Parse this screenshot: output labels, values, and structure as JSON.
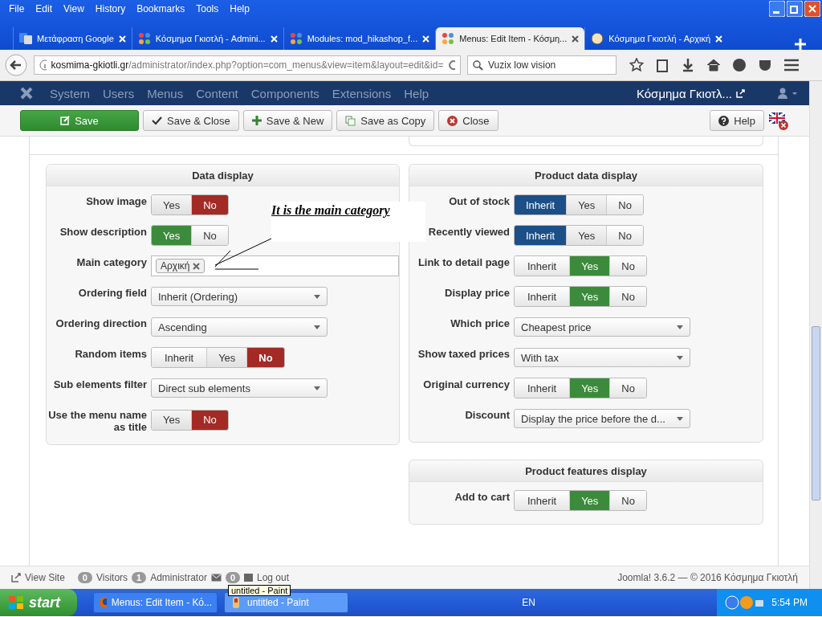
{
  "menu_bar": [
    "File",
    "Edit",
    "View",
    "History",
    "Bookmarks",
    "Tools",
    "Help"
  ],
  "tabs": [
    {
      "label": "Μετάφραση Google",
      "selected": false
    },
    {
      "label": "Κόσμημα Γκιοτλή - Admini...",
      "selected": false
    },
    {
      "label": "Modules: mod_hikashop_f...",
      "selected": false
    },
    {
      "label": "Menus: Edit Item - Κόσμη...",
      "selected": true
    },
    {
      "label": "Κόσμημα Γκιοτλή - Αρχική",
      "selected": false
    }
  ],
  "address": {
    "domain": "kosmima-gkiotli.gr",
    "path": "/administrator/index.php?option=com_menus&view=item&layout=edit&id="
  },
  "search": {
    "value": "Vuzix low vision"
  },
  "admin_menu": [
    "System",
    "Users",
    "Menus",
    "Content",
    "Components",
    "Extensions",
    "Help"
  ],
  "site_name": "Κόσμημα Γκιοτλ...",
  "toolbar": [
    {
      "label": "Save",
      "kind": "save"
    },
    {
      "label": "Save & Close",
      "kind": "check"
    },
    {
      "label": "Save & New",
      "kind": "new"
    },
    {
      "label": "Save as Copy",
      "kind": "copy"
    },
    {
      "label": "Close",
      "kind": "close"
    }
  ],
  "help_button": "Help",
  "panels": [
    {
      "title": "Data display",
      "rows": [
        {
          "label": "Show image",
          "kind": "toggle",
          "options": [
            {
              "label": "Yes",
              "kind": "yes",
              "selected": false
            },
            {
              "label": "No",
              "kind": "no",
              "selected": true
            }
          ]
        },
        {
          "label": "Show description",
          "kind": "toggle",
          "options": [
            {
              "label": "Yes",
              "kind": "yes",
              "selected": true
            },
            {
              "label": "No",
              "kind": "no",
              "selected": false
            }
          ]
        },
        {
          "label": "Main category",
          "kind": "tags",
          "tags": [
            "Αρχική"
          ]
        },
        {
          "label": "Ordering field",
          "kind": "select",
          "value": "Inherit (Ordering)"
        },
        {
          "label": "Ordering direction",
          "kind": "select",
          "value": "Ascending"
        },
        {
          "label": "Random items",
          "kind": "toggle",
          "options": [
            {
              "label": "Inherit",
              "kind": "inherit",
              "selected": false
            },
            {
              "label": "Yes",
              "kind": "yes",
              "selected": false
            },
            {
              "label": "No",
              "kind": "no",
              "selected": true
            }
          ]
        },
        {
          "label": "Sub elements filter",
          "kind": "select",
          "value": "Direct sub elements"
        },
        {
          "label": "Use the menu name as title",
          "kind": "toggle",
          "options": [
            {
              "label": "Yes",
              "kind": "yes",
              "selected": false
            },
            {
              "label": "No",
              "kind": "no",
              "selected": true
            }
          ]
        }
      ]
    },
    {
      "title": "Product data display",
      "rows": [
        {
          "label": "Out of stock",
          "kind": "toggle",
          "options": [
            {
              "label": "Inherit",
              "kind": "inherit",
              "selected": true
            },
            {
              "label": "Yes",
              "kind": "yes",
              "selected": false
            },
            {
              "label": "No",
              "kind": "no",
              "selected": false
            }
          ]
        },
        {
          "label": "Recently viewed",
          "kind": "toggle",
          "options": [
            {
              "label": "Inherit",
              "kind": "inherit",
              "selected": true
            },
            {
              "label": "Yes",
              "kind": "yes",
              "selected": false
            },
            {
              "label": "No",
              "kind": "no",
              "selected": false
            }
          ]
        },
        {
          "label": "Link to detail page",
          "kind": "toggle",
          "options": [
            {
              "label": "Inherit",
              "kind": "inherit",
              "selected": false
            },
            {
              "label": "Yes",
              "kind": "yes",
              "selected": true
            },
            {
              "label": "No",
              "kind": "no",
              "selected": false
            }
          ]
        },
        {
          "label": "Display price",
          "kind": "toggle",
          "options": [
            {
              "label": "Inherit",
              "kind": "inherit",
              "selected": false
            },
            {
              "label": "Yes",
              "kind": "yes",
              "selected": true
            },
            {
              "label": "No",
              "kind": "no",
              "selected": false
            }
          ]
        },
        {
          "label": "Which price",
          "kind": "select",
          "value": "Cheapest price"
        },
        {
          "label": "Show taxed prices",
          "kind": "select",
          "value": "With tax"
        },
        {
          "label": "Original currency",
          "kind": "toggle",
          "options": [
            {
              "label": "Inherit",
              "kind": "inherit",
              "selected": false
            },
            {
              "label": "Yes",
              "kind": "yes",
              "selected": true
            },
            {
              "label": "No",
              "kind": "no",
              "selected": false
            }
          ]
        },
        {
          "label": "Discount",
          "kind": "select",
          "value": "Display the price before the d..."
        }
      ]
    },
    {
      "title": "Product features display",
      "rows": [
        {
          "label": "Add to cart",
          "kind": "toggle",
          "options": [
            {
              "label": "Inherit",
              "kind": "inherit",
              "selected": false
            },
            {
              "label": "Yes",
              "kind": "yes",
              "selected": true
            },
            {
              "label": "No",
              "kind": "no",
              "selected": false
            }
          ]
        }
      ]
    }
  ],
  "annotation": "It is the main category",
  "status_bar": {
    "view_site": "View Site",
    "visitors_count": "0",
    "visitors": "Visitors",
    "admins_count": "1",
    "admins": "Administrator",
    "messages_count": "0",
    "logout": "Log out",
    "footer": "Joomla! 3.6.2 — © 2016 Κόσμημα Γκιοτλή"
  },
  "tooltip": "untitled - Paint",
  "taskbar": {
    "start": "start",
    "tasks": [
      {
        "label": "Menus: Edit Item - Κό..."
      },
      {
        "label": "untitled - Paint"
      }
    ],
    "language": "EN",
    "time": "5:54 PM"
  }
}
